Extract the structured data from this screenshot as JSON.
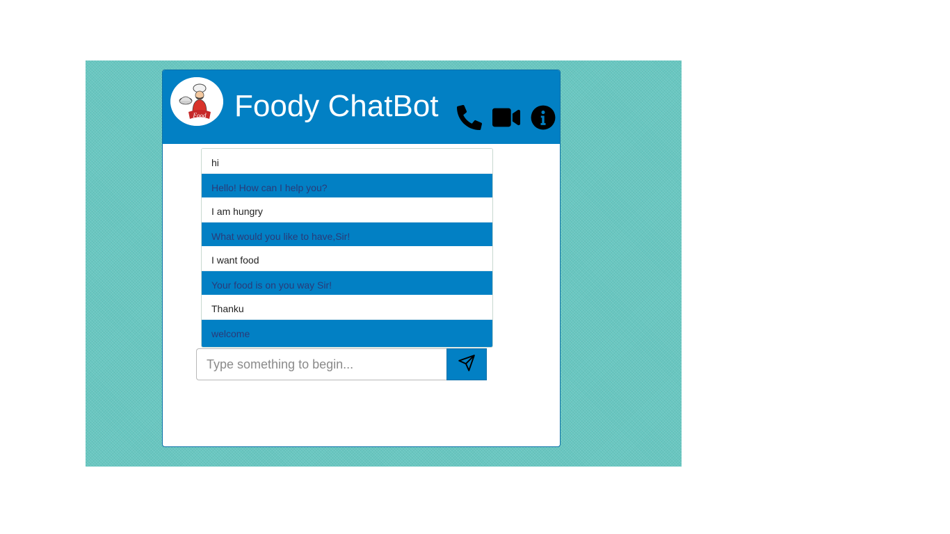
{
  "header": {
    "title": "Foody ChatBot",
    "avatar_icon": "chef-logo-icon",
    "icons": [
      "phone-icon",
      "video-camera-icon",
      "info-icon"
    ]
  },
  "messages": [
    {
      "sender": "user",
      "text": "hi"
    },
    {
      "sender": "bot",
      "text": "Hello! How can I help you?"
    },
    {
      "sender": "user",
      "text": "I am hungry"
    },
    {
      "sender": "bot",
      "text": "What would you like to have,Sir!"
    },
    {
      "sender": "user",
      "text": "I want food"
    },
    {
      "sender": "bot",
      "text": "Your food is on you way Sir!"
    },
    {
      "sender": "user",
      "text": "Thanku"
    },
    {
      "sender": "bot",
      "text": "welcome"
    }
  ],
  "composer": {
    "placeholder": "Type something to begin...",
    "value": "",
    "send_icon": "paper-plane-icon"
  },
  "colors": {
    "background_panel": "#68c7c1",
    "header": "#0280c4",
    "bot_message": "#0280c4",
    "bot_text": "#2a3a78"
  }
}
